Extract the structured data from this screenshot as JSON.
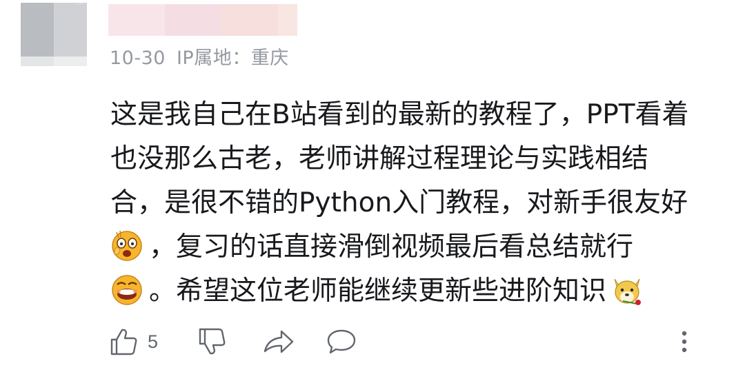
{
  "comment": {
    "date": "10-30",
    "ip_location": "IP属地：重庆",
    "lines": [
      "这是我自己在B站看到的最新的教程了，PPT看着",
      "也没那么古老，老师讲解过程理论与实践相结",
      "合，是很不错的Python入门教程，对新手很友好",
      "，复习的话直接滑倒视频最后看总结就行",
      "。希望这位老师能继续更新些进阶知识"
    ],
    "emojis": [
      "shocked-face-emoji",
      "grinning-face-emoji",
      "doge-rose-emoji"
    ]
  },
  "actions": {
    "like_count": "5",
    "icons": [
      "thumbs-up-icon",
      "thumbs-down-icon",
      "share-icon",
      "reply-bubble-icon",
      "more-vertical-icon"
    ]
  },
  "colors": {
    "text_primary": "#18191c",
    "text_secondary": "#9499a0",
    "icon_gray": "#61666d",
    "emoji_yellow": "#f7b52c"
  }
}
